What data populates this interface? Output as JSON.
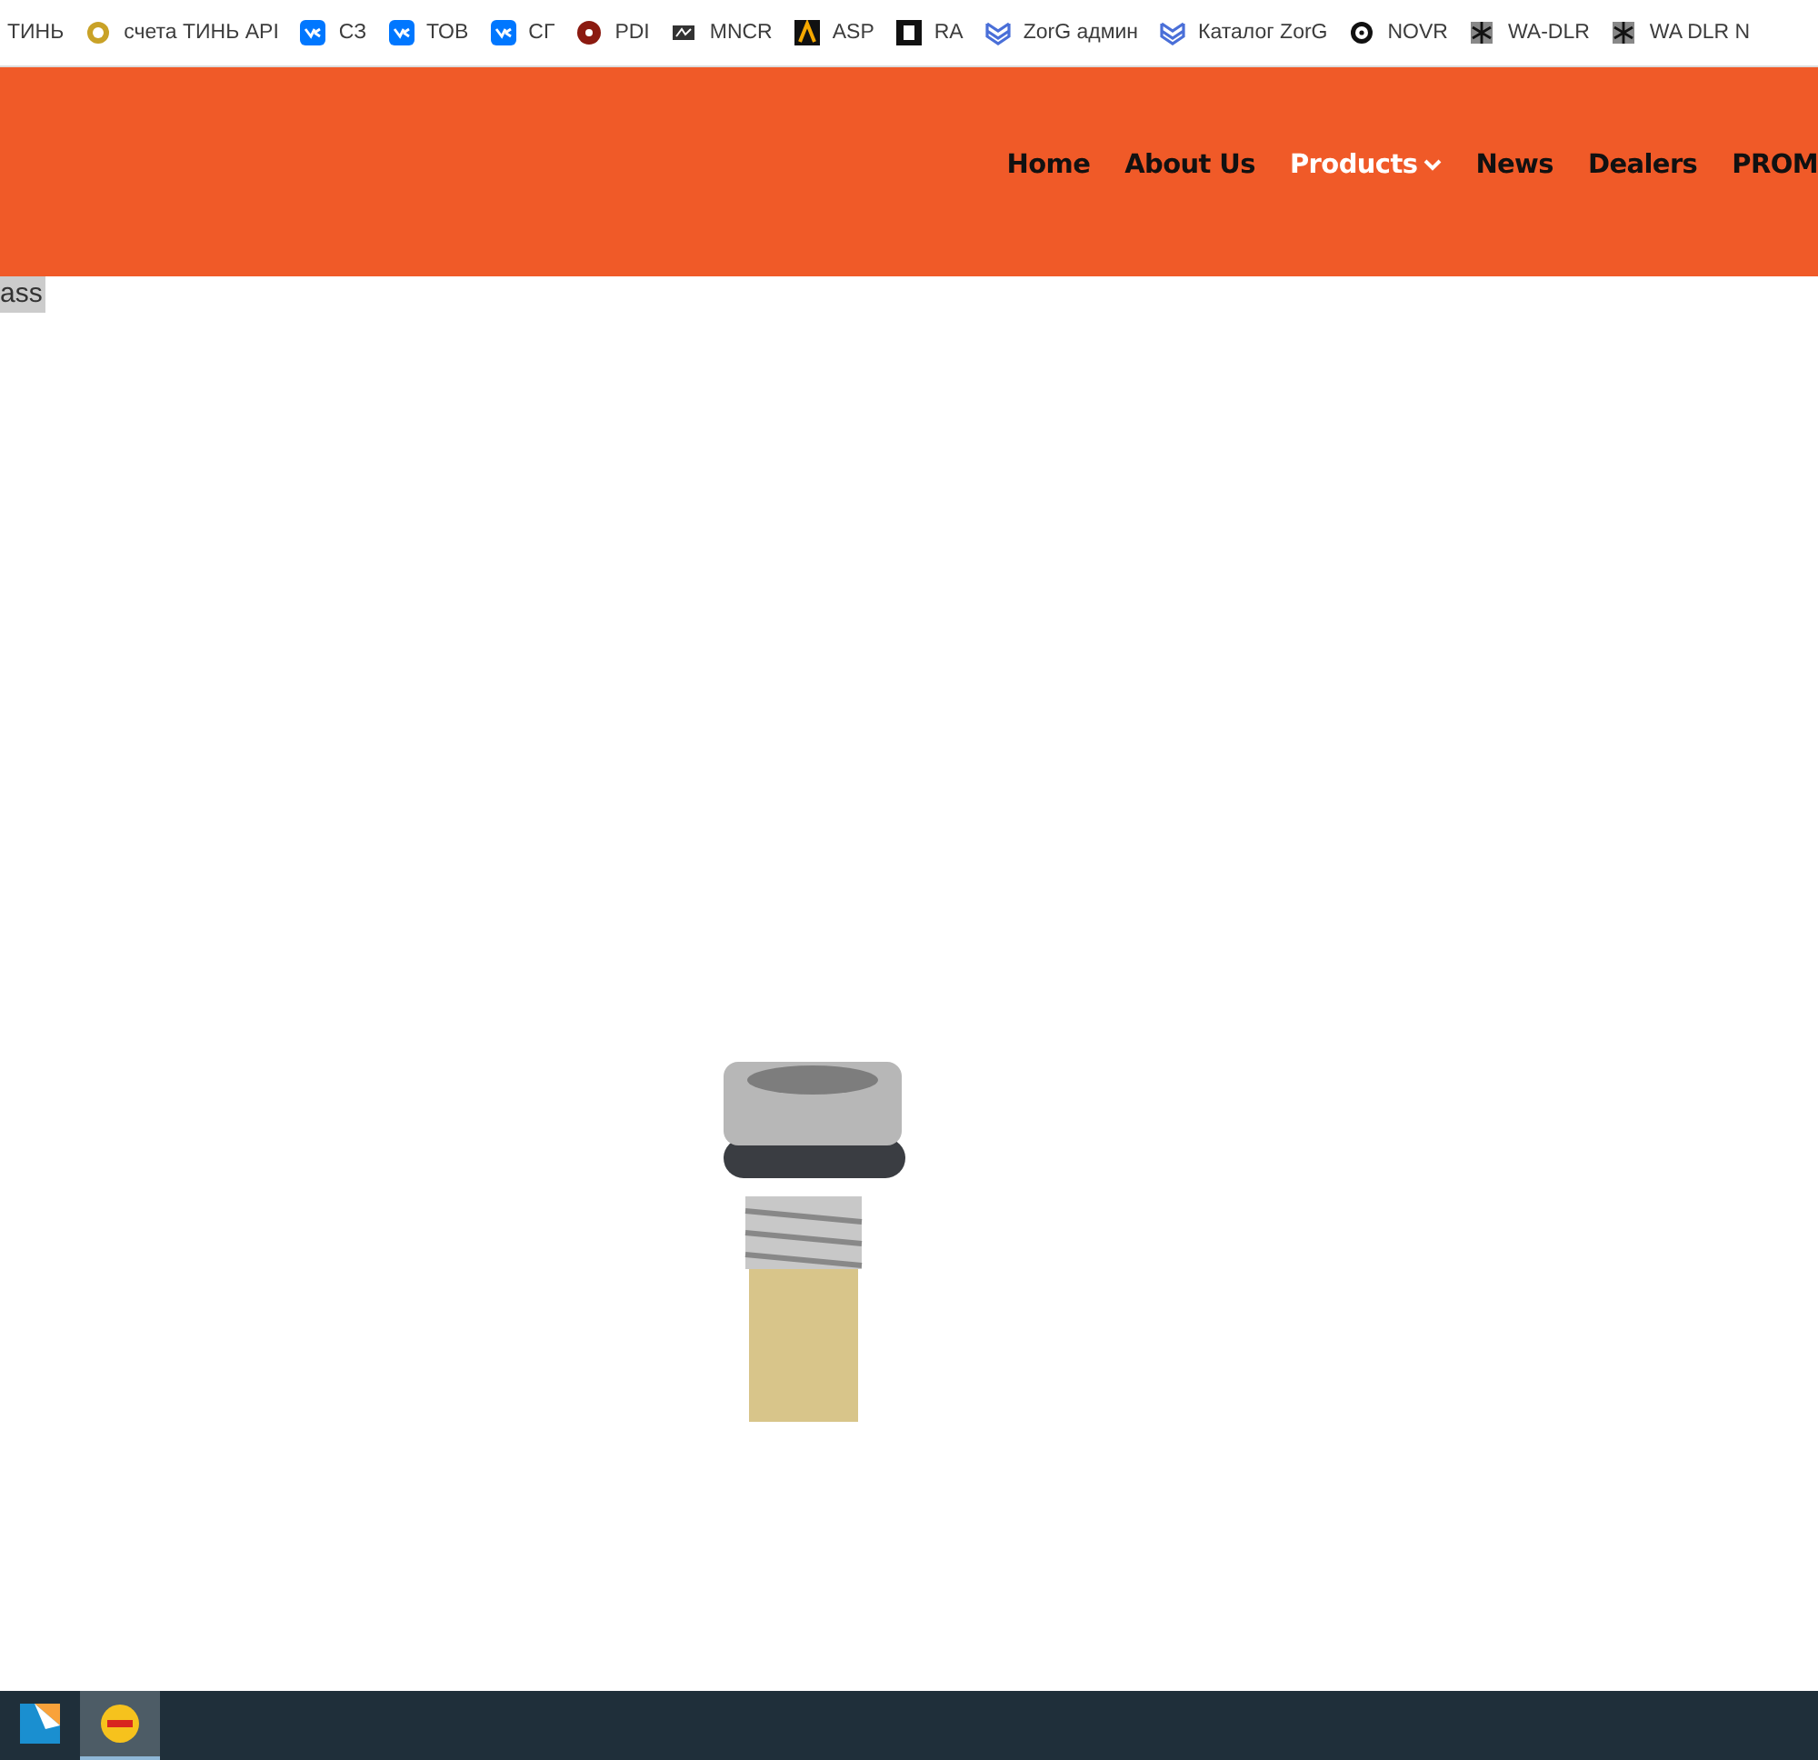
{
  "bookmarks": [
    {
      "label": "ТИНЬ",
      "kind": "none"
    },
    {
      "label": "счета ТИНЬ API",
      "kind": "coin"
    },
    {
      "label": "СЗ",
      "kind": "vk"
    },
    {
      "label": "ТОВ",
      "kind": "vk"
    },
    {
      "label": "СГ",
      "kind": "vk"
    },
    {
      "label": "PDI",
      "kind": "redball"
    },
    {
      "label": "MNCR",
      "kind": "card"
    },
    {
      "label": "ASP",
      "kind": "arch"
    },
    {
      "label": "RA",
      "kind": "square"
    },
    {
      "label": "ZorG админ",
      "kind": "shield"
    },
    {
      "label": "Каталог ZorG",
      "kind": "shield"
    },
    {
      "label": "NOVR",
      "kind": "wheel"
    },
    {
      "label": "WA-DLR",
      "kind": "pattern"
    },
    {
      "label": "WA DLR N",
      "kind": "pattern"
    }
  ],
  "nav": [
    {
      "label": "Home",
      "selected": false,
      "dropdown": false
    },
    {
      "label": "About Us",
      "selected": false,
      "dropdown": false
    },
    {
      "label": "Products",
      "selected": true,
      "dropdown": true
    },
    {
      "label": "News",
      "selected": false,
      "dropdown": false
    },
    {
      "label": "Dealers",
      "selected": false,
      "dropdown": false
    },
    {
      "label": "PROM",
      "selected": false,
      "dropdown": false
    }
  ],
  "content": {
    "tag": "ass"
  },
  "taskbar": [
    {
      "kind": "files",
      "active": false
    },
    {
      "kind": "onec",
      "active": true
    }
  ]
}
